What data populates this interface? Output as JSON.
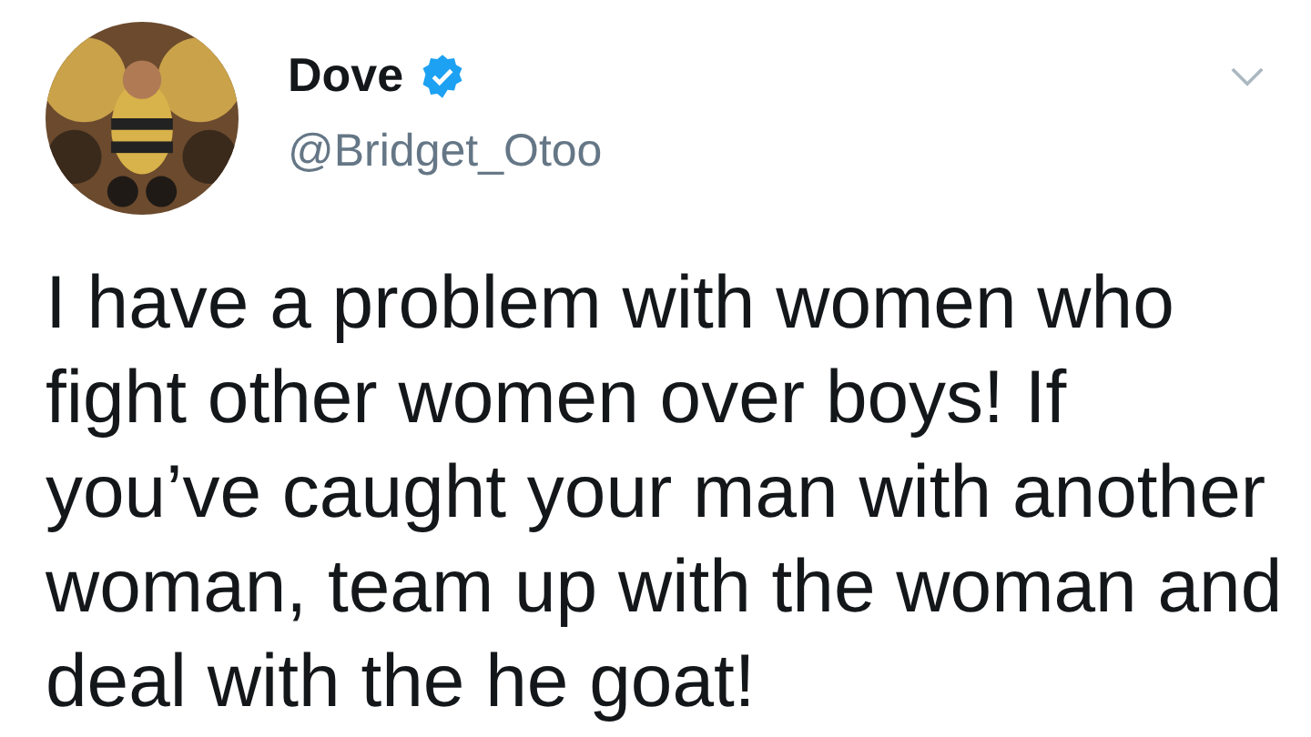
{
  "tweet": {
    "author": {
      "name": "Dove",
      "verified": true,
      "handle": "@Bridget_Otoo"
    },
    "text": "I have a problem with women who fight other women over boys! If you’ve caught your man with another woman, team up with the woman and deal with the he goat!"
  }
}
